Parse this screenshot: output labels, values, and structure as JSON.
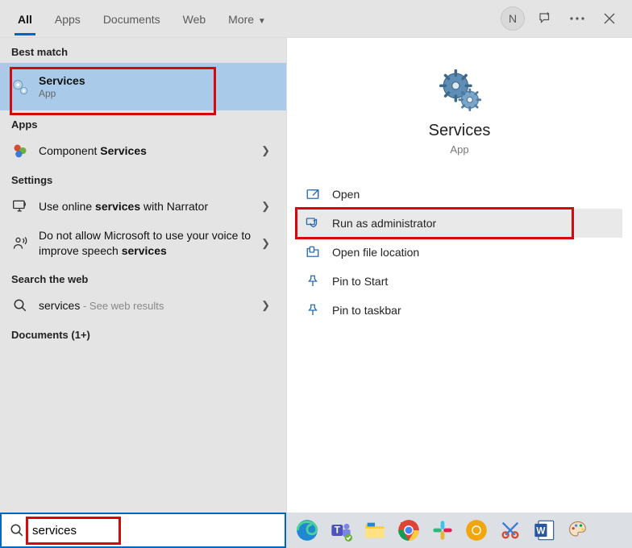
{
  "tabs": {
    "all": "All",
    "apps": "Apps",
    "documents": "Documents",
    "web": "Web",
    "more": "More"
  },
  "avatar_letter": "N",
  "left": {
    "best_match_heading": "Best match",
    "best_match": {
      "title": "Services",
      "sub": "App"
    },
    "apps_heading": "Apps",
    "component_services_pre": "Component ",
    "component_services_bold": "Services",
    "settings_heading": "Settings",
    "setting1_pre": "Use online ",
    "setting1_bold": "services",
    "setting1_post": " with Narrator",
    "setting2_pre": "Do not allow Microsoft to use your voice to improve speech ",
    "setting2_bold": "services",
    "search_web_heading": "Search the web",
    "web_term": "services",
    "web_sub": " - See web results",
    "documents_heading": "Documents (1+)"
  },
  "right": {
    "title": "Services",
    "sub": "App",
    "actions": {
      "open": "Open",
      "run_admin": "Run as administrator",
      "open_loc": "Open file location",
      "pin_start": "Pin to Start",
      "pin_taskbar": "Pin to taskbar"
    }
  },
  "search": {
    "value": "services"
  }
}
